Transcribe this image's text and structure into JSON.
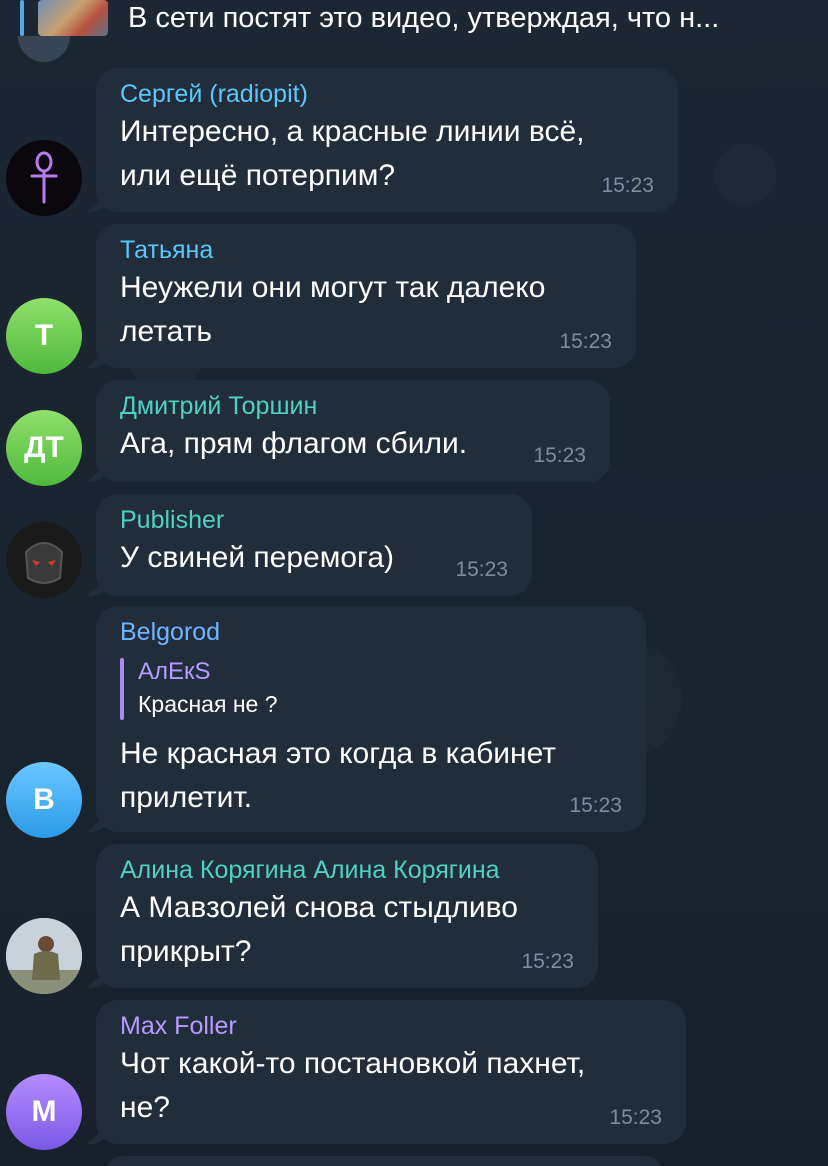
{
  "pinned": {
    "text": "В сети постят это видео, утверждая, что н...",
    "thumbnail_icon": "video-thumbnail"
  },
  "messages": [
    {
      "sender": "Сергей (radiopit)",
      "sender_color": "#5ac8fa",
      "lines": [
        "Интересно, а красные линии всё,",
        "или ещё потерпим?"
      ],
      "time": "15:23",
      "avatar_icon": "ankh-icon"
    },
    {
      "sender": "Татьяна",
      "sender_color": "#5ac8fa",
      "lines": [
        "Неужели они могут так далеко",
        "летать"
      ],
      "time": "15:23",
      "avatar_initials": "Т"
    },
    {
      "sender": "Дмитрий Торшин",
      "sender_color": "#4fd1c5",
      "lines": [
        "Ага, прям флагом сбили."
      ],
      "time": "15:23",
      "avatar_initials": "ДТ"
    },
    {
      "sender": "Publisher",
      "sender_color": "#4fd1c5",
      "lines": [
        "У свиней перемога)"
      ],
      "time": "15:23",
      "avatar_icon": "mask-icon"
    },
    {
      "sender": "Belgorod",
      "sender_color": "#6fb6ff",
      "reply": {
        "author": "АлЕкS",
        "text": "Красная не ?"
      },
      "lines": [
        "Не красная это когда в кабинет",
        "прилетит."
      ],
      "time": "15:23",
      "avatar_initials": "B"
    },
    {
      "sender": "Алина Корягина Алина Корягина",
      "sender_color": "#4fd1c5",
      "lines": [
        "А Мавзолей снова стыдливо",
        "прикрыт?"
      ],
      "time": "15:23",
      "avatar_icon": "photo-avatar"
    },
    {
      "sender": "Max Foller",
      "sender_color": "#b79bff",
      "lines": [
        "Чот какой-то постановкой пахнет,",
        "не?"
      ],
      "time": "15:23",
      "avatar_initials": "M"
    }
  ]
}
